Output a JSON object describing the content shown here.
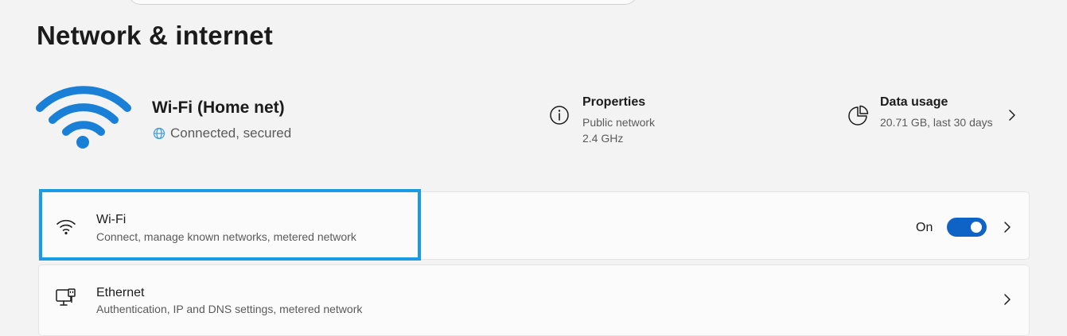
{
  "page": {
    "title": "Network & internet"
  },
  "current_network": {
    "name": "Wi-Fi (Home net)",
    "status": "Connected, secured",
    "icon": "wifi-icon",
    "accent_color": "#1a7fd6"
  },
  "properties": {
    "title": "Properties",
    "network_type": "Public network",
    "band": "2.4 GHz",
    "icon": "info-icon"
  },
  "data_usage": {
    "title": "Data usage",
    "summary": "20.71 GB, last 30 days",
    "icon": "pie-chart-icon"
  },
  "settings": [
    {
      "title": "Wi-Fi",
      "subtitle": "Connect, manage known networks, metered network",
      "icon": "wifi-icon",
      "toggle_label": "On",
      "toggle_on": true
    },
    {
      "title": "Ethernet",
      "subtitle": "Authentication, IP and DNS settings, metered network",
      "icon": "ethernet-icon"
    }
  ],
  "colors": {
    "background": "#f3f3f3",
    "card": "#fbfbfb",
    "toggle_on": "#0f63c7",
    "highlight_border": "#1a9be6"
  }
}
